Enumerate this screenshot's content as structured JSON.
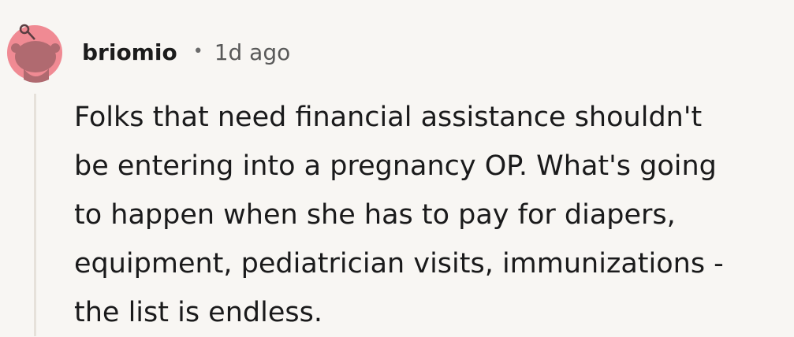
{
  "comment": {
    "author": "briomio",
    "separator": "•",
    "timestamp": "1d ago",
    "avatar_icon": "reddit-snoo-avatar-icon",
    "avatar_color": "#f08a93",
    "body_lines": [
      "Folks that need financial assistance shouldn't",
      "be entering into a pregnancy OP. What's going",
      "to happen when she has to pay for diapers,",
      "equipment, pediatrician visits, immunizations -",
      "the list is endless."
    ]
  }
}
